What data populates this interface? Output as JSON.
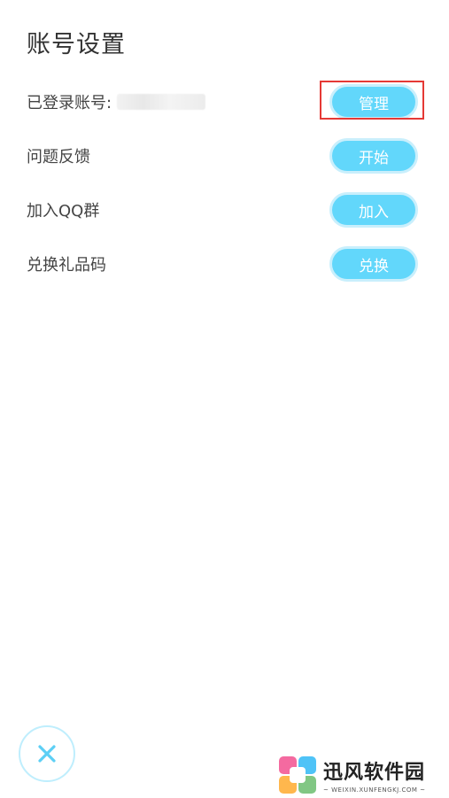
{
  "header": {
    "title": "账号设置"
  },
  "rows": [
    {
      "label": "已登录账号:",
      "button": "管理"
    },
    {
      "label": "问题反馈",
      "button": "开始"
    },
    {
      "label": "加入QQ群",
      "button": "加入"
    },
    {
      "label": "兑换礼品码",
      "button": "兑换"
    }
  ],
  "close": {
    "icon": "close-icon"
  },
  "watermark": {
    "title": "迅风软件园",
    "subtitle": "~ WEIXIN.XUNFENGKJ.COM ~"
  },
  "colors": {
    "accent": "#62d7fb",
    "highlight": "#e53935",
    "close_icon": "#5ccff5"
  }
}
